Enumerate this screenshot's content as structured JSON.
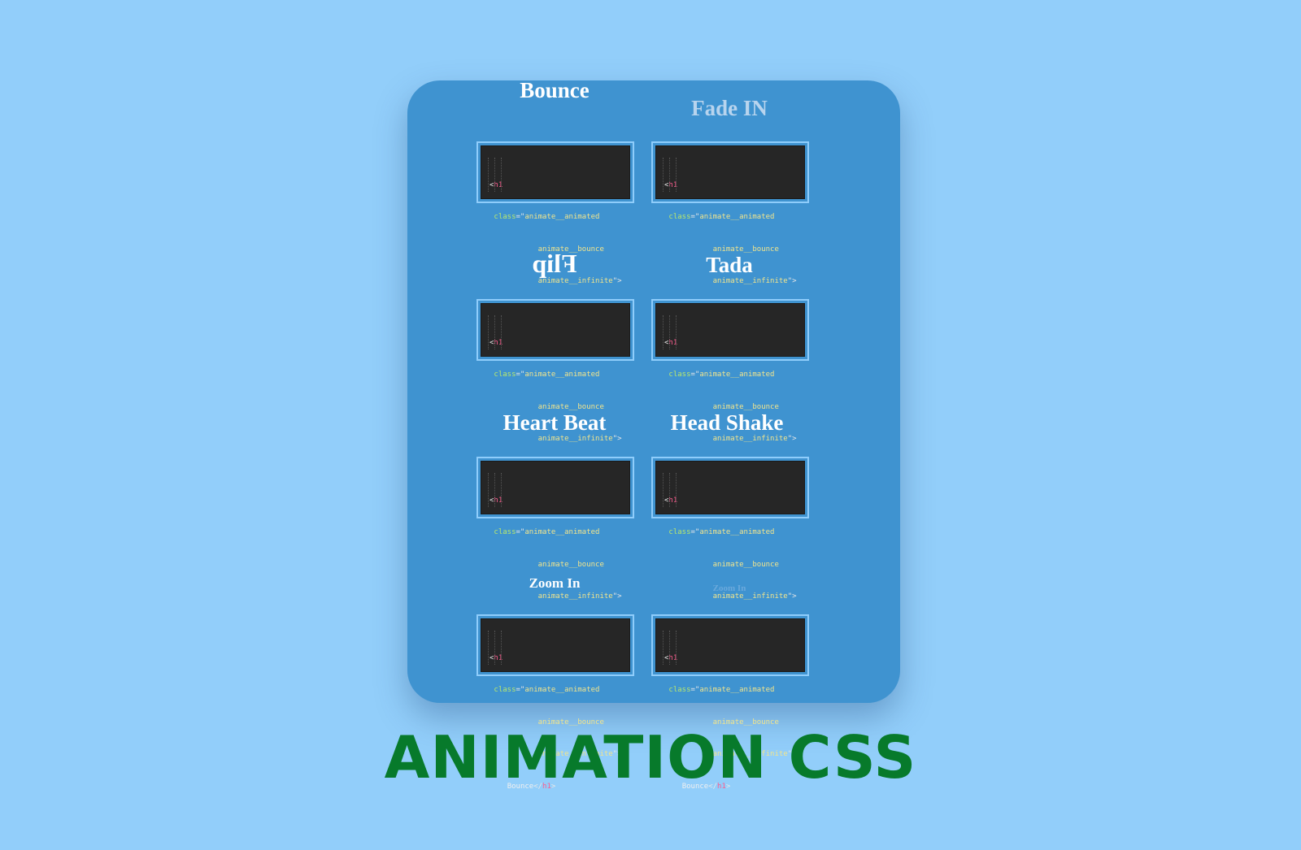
{
  "demos": [
    {
      "title": "Bounce"
    },
    {
      "title": "Fade IN"
    },
    {
      "title": "Flip"
    },
    {
      "title": "Tada"
    },
    {
      "title": "Heart Beat"
    },
    {
      "title": "Head Shake"
    },
    {
      "title": "Zoom In"
    },
    {
      "title": "Zoom In"
    }
  ],
  "code": {
    "open_bracket": "<",
    "tag": "h1",
    "attr": "class",
    "equals_quote": "=\"",
    "class1": "animate__animated",
    "class2": "animate__bounce",
    "class3": "animate__infinite",
    "close_quote": "\">",
    "text": "Bounce",
    "close_open": "</",
    "close_end": ">"
  },
  "main_title": "ANIMATION CSS",
  "colors": {
    "background": "#92cefa",
    "card": "#3f93d0",
    "title_green": "#077a2b",
    "code_bg": "#262626"
  }
}
